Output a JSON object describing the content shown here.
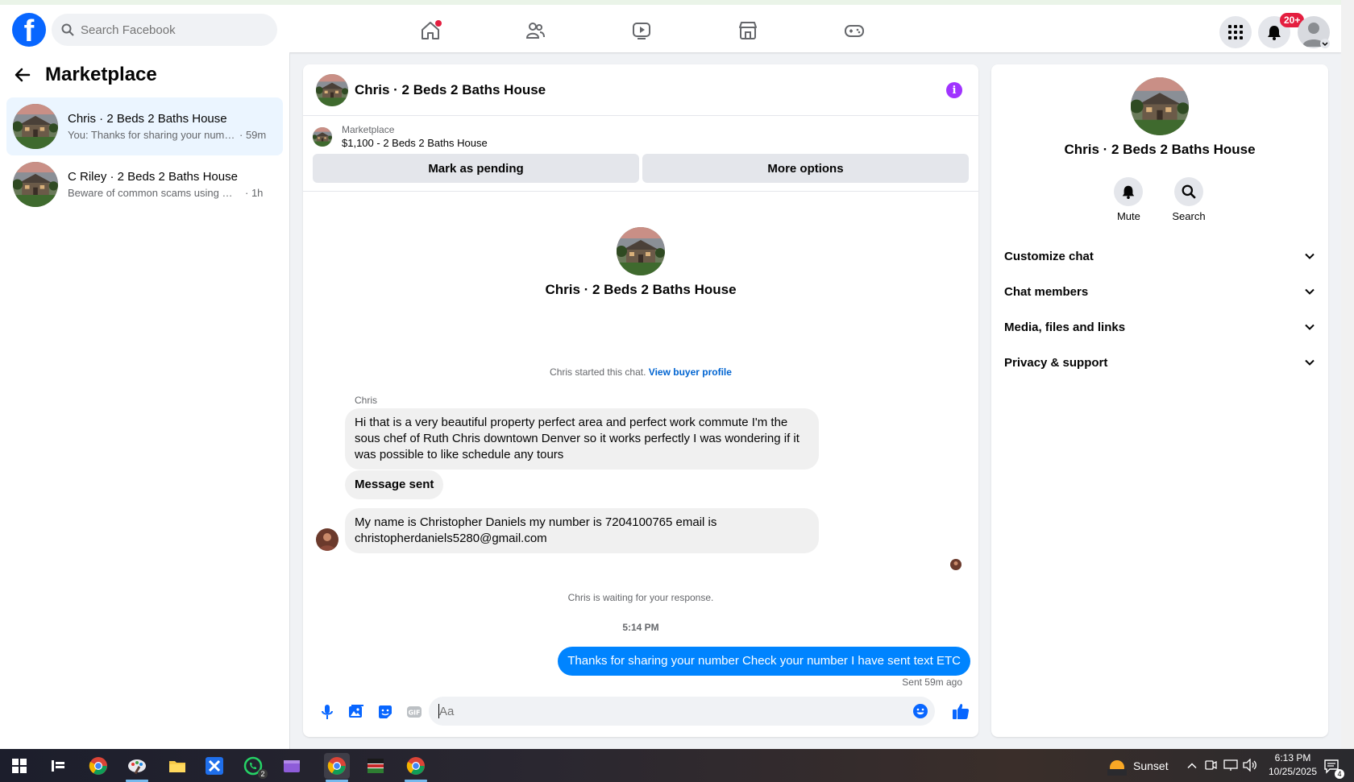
{
  "topbar": {
    "search_placeholder": "Search Facebook",
    "notifications_badge": "20+",
    "nav": [
      "home-icon",
      "friends-icon",
      "video-icon",
      "marketplace-icon",
      "gaming-icon"
    ]
  },
  "sidebar": {
    "title": "Marketplace",
    "conversations": [
      {
        "name": "Chris · 2 Beds 2 Baths House",
        "snippet": "You: Thanks for sharing your numbe...",
        "time": "· 59m",
        "active": true
      },
      {
        "name": "C Riley · 2 Beds 2 Baths House",
        "snippet": "Beware of common scams using pay...",
        "time": "· 1h",
        "active": false
      }
    ]
  },
  "chat": {
    "title": "Chris · 2 Beds 2 Baths House",
    "listing": {
      "label": "Marketplace",
      "price_title": "$1,100 - 2 Beds 2 Baths House",
      "btn_pending": "Mark as pending",
      "btn_more": "More options"
    },
    "profile_name": "Chris · 2 Beds 2 Baths House",
    "started_text": "Chris started this chat.",
    "started_link": "View buyer profile",
    "sender": "Chris",
    "messages": [
      "Hi that is a very beautiful property perfect area and perfect work commute I'm the sous chef of Ruth Chris downtown Denver so it works perfectly I was wondering if it was possible to like schedule any tours",
      "Message sent",
      "My name is Christopher Daniels my number is 7204100765 email is christopherdaniels5280@gmail.com"
    ],
    "waiting_text": "Chris is waiting for your response.",
    "timestamp": "5:14 PM",
    "sent_message": "Thanks for sharing your number Check your number I have sent text ETC",
    "sent_status": "Sent 59m ago",
    "composer_placeholder": "Aa"
  },
  "right_panel": {
    "name": "Chris · 2 Beds 2 Baths House",
    "actions": {
      "mute": "Mute",
      "search": "Search"
    },
    "sections": [
      "Customize chat",
      "Chat members",
      "Media, files and links",
      "Privacy & support"
    ]
  },
  "taskbar": {
    "weather": "Sunset",
    "time": "6:13 PM",
    "date": "10/25/2025",
    "whatsapp_badge": "2",
    "notif_count": "4"
  },
  "colors": {
    "brand": "#0866ff",
    "sent_bubble": "#0084ff",
    "active_item": "#ebf5ff",
    "info": "#a033ff"
  }
}
